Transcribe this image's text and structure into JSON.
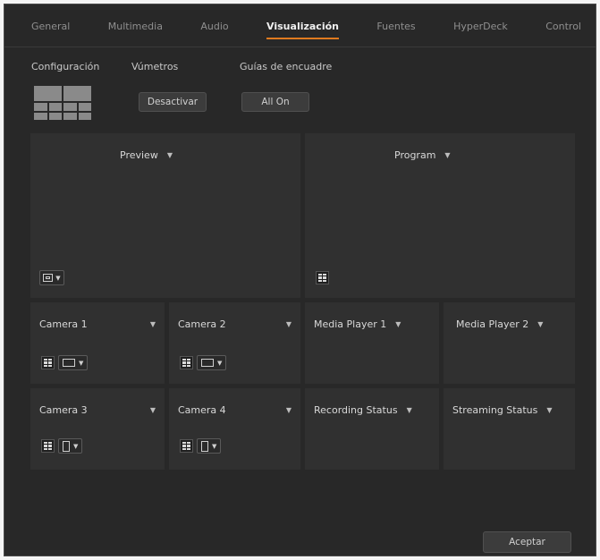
{
  "tabs": [
    "General",
    "Multimedia",
    "Audio",
    "Visualización",
    "Fuentes",
    "HyperDeck",
    "Control"
  ],
  "active_tab": "Visualización",
  "sections": {
    "config_label": "Configuración",
    "meters_label": "Vúmetros",
    "guides_label": "Guías de encuadre"
  },
  "buttons": {
    "meters_toggle": "Desactivar",
    "guides_toggle": "All On",
    "accept": "Aceptar"
  },
  "large_views": [
    {
      "label": "Preview"
    },
    {
      "label": "Program"
    }
  ],
  "small_views": [
    {
      "label": "Camera 1"
    },
    {
      "label": "Camera 2"
    },
    {
      "label": "Media Player 1"
    },
    {
      "label": "Media Player 2"
    },
    {
      "label": "Camera 3"
    },
    {
      "label": "Camera 4"
    },
    {
      "label": "Recording Status"
    },
    {
      "label": "Streaming Status"
    }
  ],
  "colors": {
    "accent": "#e07a1f",
    "background": "#282828",
    "panel": "#303030"
  },
  "icons": [
    "layout-thumbnail-icon",
    "safe-area-icon",
    "audio-meter-icon",
    "chevron-down-icon"
  ]
}
